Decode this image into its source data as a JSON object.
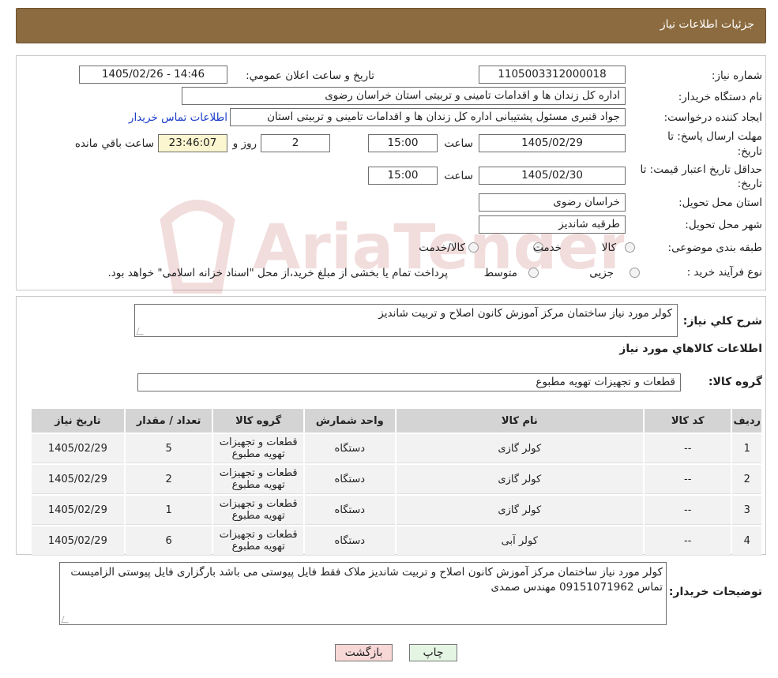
{
  "header": {
    "title": "جزئیات اطلاعات نیاز"
  },
  "form": {
    "need_number_label": "شماره نیاز:",
    "need_number": "1105003312000018",
    "announce_label": "تاریخ و ساعت اعلان عمومي:",
    "announce_value": "1405/02/26 - 14:46",
    "buyer_org_label": "نام دستگاه خریدار:",
    "buyer_org": "اداره کل زندان ها و اقدامات تامینی و تربیتی استان خراسان رضوی",
    "creator_label": "ایجاد کننده درخواست:",
    "creator": "جواد قنبری مسئول پشتیبانی اداره کل زندان ها و اقدامات تامینی و تربیتی استان",
    "contact_link": "اطلاعات تماس خریدار",
    "deadline_label_1": "مهلت ارسال پاسخ: تا",
    "deadline_label_2": "تاریخ:",
    "deadline_date": "1405/02/29",
    "time_label": "ساعت",
    "deadline_time": "15:00",
    "days_value": "2",
    "days_label": "روز و",
    "remaining_time": "23:46:07",
    "remaining_label": "ساعت باقي مانده",
    "validity_label_1": "حداقل تاریخ اعتبار قیمت: تا",
    "validity_label_2": "تاریخ:",
    "validity_date": "1405/02/30",
    "validity_time": "15:00",
    "province_label": "استان محل تحویل:",
    "province": "خراسان رضوی",
    "city_label": "شهر محل تحویل:",
    "city": "طرقبه شاندیز",
    "category_label": "طبقه بندی موضوعی:",
    "category_options": [
      "کالا",
      "خدمت",
      "کالا/خدمت"
    ],
    "process_label": "نوع فرآیند خرید :",
    "process_options": [
      "جزیی",
      "متوسط"
    ],
    "process_note": "پرداخت تمام یا بخشی از مبلغ خرید،از محل \"اسناد خزانه اسلامی\" خواهد بود."
  },
  "summary": {
    "desc_label": "شرح کلي نیاز:",
    "desc_value": "کولر مورد نیاز ساختمان مرکز آموزش کانون اصلاح و تربیت شاندیز",
    "goods_title": "اطلاعات کالاهاي مورد نیاز",
    "group_label": "گروه کالا:",
    "group_value": "قطعات و تجهیزات تهویه مطبوع"
  },
  "table": {
    "headers": [
      "رديف",
      "کد کالا",
      "نام کالا",
      "واحد شمارش",
      "گروه کالا",
      "تعداد / مقدار",
      "تاریخ نیاز"
    ],
    "rows": [
      [
        "1",
        "--",
        "کولر گازی",
        "دستگاه",
        "قطعات و تجهیزات تهویه مطبوع",
        "5",
        "1405/02/29"
      ],
      [
        "2",
        "--",
        "کولر گازی",
        "دستگاه",
        "قطعات و تجهیزات تهویه مطبوع",
        "2",
        "1405/02/29"
      ],
      [
        "3",
        "--",
        "کولر گازی",
        "دستگاه",
        "قطعات و تجهیزات تهویه مطبوع",
        "1",
        "1405/02/29"
      ],
      [
        "4",
        "--",
        "کولر آبی",
        "دستگاه",
        "قطعات و تجهیزات تهویه مطبوع",
        "6",
        "1405/02/29"
      ]
    ]
  },
  "buyer_notes": {
    "label": "توضیحات خریدار:",
    "text": "کولر مورد نیاز ساختمان مرکز آموزش کانون اصلاح و تربیت شاندیز ملاک فقط فایل پیوستی می باشد بارگزاری فایل پیوستی الزامیست تماس 09151071962 مهندس صمدی"
  },
  "buttons": {
    "print": "چاپ",
    "back": "بازگشت"
  },
  "watermark": {
    "text": "AriaTender.neT"
  },
  "colors": {
    "header_bg": "#8b6b3f",
    "link": "#1a3cc9",
    "back_btn": "#f8d7d7",
    "print_btn": "#e4f5e4"
  }
}
